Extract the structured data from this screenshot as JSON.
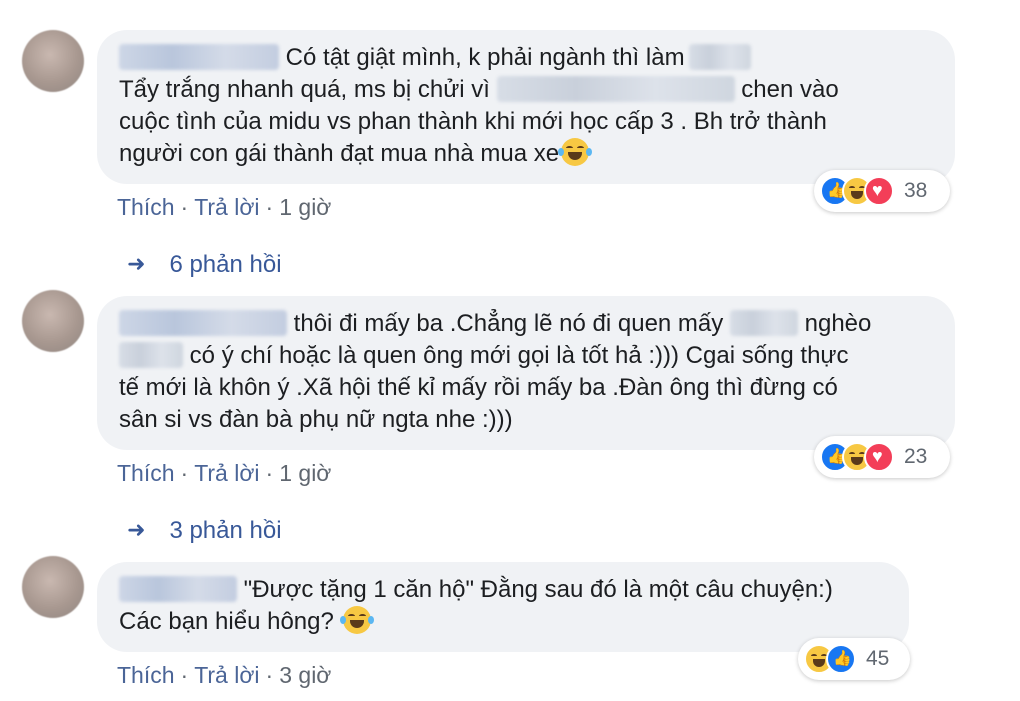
{
  "comments": [
    {
      "line1": "Có tật giật mình, k phải ngành thì làm",
      "line2a": "Tẩy trắng nhanh quá, ms bị chửi vì",
      "line2b": "chen vào",
      "line3": "cuộc tình của midu vs phan thành khi mới học cấp 3 . Bh trở thành",
      "line4": "người con gái thành đạt mua nhà mua xe",
      "actions": {
        "like": "Thích",
        "reply": "Trả lời",
        "time": "1 giờ"
      },
      "reaction_count": "38",
      "replies": "6 phản hồi"
    },
    {
      "line1a": "thôi đi mấy ba .Chẳng lẽ nó đi quen mấy",
      "line1b": "nghèo",
      "line2": "có ý chí hoặc là quen ông mới gọi là tốt hả :))) Cgai sống thực",
      "line3": "tế mới là khôn ý .Xã hội thế kỉ mấy rồi mấy ba .Đàn ông thì đừng có",
      "line4": "sân si vs đàn bà phụ nữ ngta nhe :)))",
      "actions": {
        "like": "Thích",
        "reply": "Trả lời",
        "time": "1 giờ"
      },
      "reaction_count": "23",
      "replies": "3 phản hồi"
    },
    {
      "line1": "\"Được tặng 1 căn hộ\" Đằng sau đó là một câu chuyện:)",
      "line2": "Các bạn hiểu hông?",
      "actions": {
        "like": "Thích",
        "reply": "Trả lời",
        "time": "3 giờ"
      },
      "reaction_count": "45"
    }
  ],
  "separator": "·",
  "reply_arrow_icon": "reply-arrow-icon",
  "colors": {
    "bubble": "#f0f2f5",
    "link": "#385898",
    "like": "#1877f2",
    "love": "#f33e58",
    "haha": "#f7c843"
  }
}
